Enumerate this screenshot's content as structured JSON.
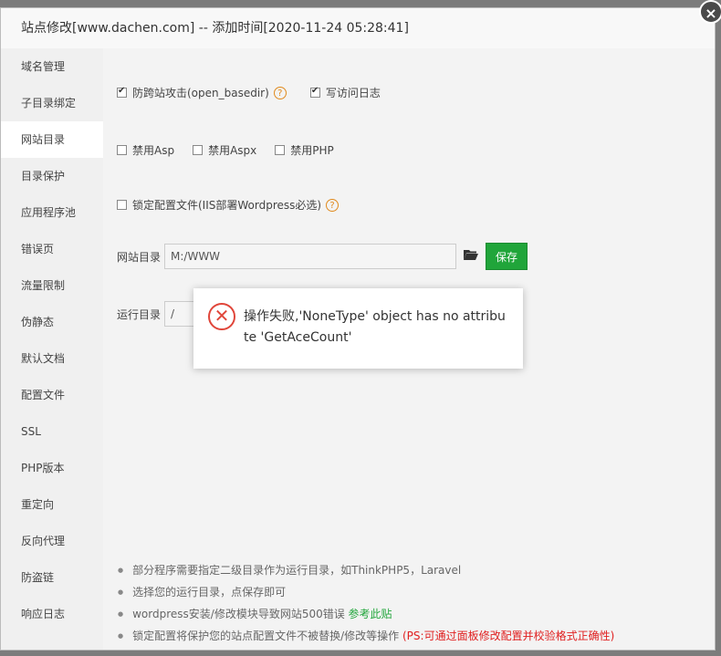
{
  "dialog": {
    "title": "站点修改[www.dachen.com] -- 添加时间[2020-11-24 05:28:41]",
    "close_symbol": "×"
  },
  "sidebar": {
    "items": [
      {
        "label": "域名管理"
      },
      {
        "label": "子目录绑定"
      },
      {
        "label": "网站目录",
        "active": true
      },
      {
        "label": "目录保护"
      },
      {
        "label": "应用程序池"
      },
      {
        "label": "错误页"
      },
      {
        "label": "流量限制"
      },
      {
        "label": "伪静态"
      },
      {
        "label": "默认文档"
      },
      {
        "label": "配置文件"
      },
      {
        "label": "SSL"
      },
      {
        "label": "PHP版本"
      },
      {
        "label": "重定向"
      },
      {
        "label": "反向代理"
      },
      {
        "label": "防盗链"
      },
      {
        "label": "响应日志"
      }
    ]
  },
  "options": {
    "open_basedir_label": "防跨站攻击(open_basedir)",
    "open_basedir_checked": true,
    "access_log_label": "写访问日志",
    "access_log_checked": true,
    "disable_asp_label": "禁用Asp",
    "disable_aspx_label": "禁用Aspx",
    "disable_php_label": "禁用PHP",
    "lock_config_label": "锁定配置文件(IIS部署Wordpress必选)",
    "help_symbol": "?"
  },
  "site_dir": {
    "label": "网站目录",
    "value": "M:/WWW",
    "save_label": "保存"
  },
  "run_dir": {
    "label": "运行目录",
    "value": "/"
  },
  "toast": {
    "message": "操作失败,'NoneType' object has no attribute 'GetAceCount'",
    "icon_symbol": "✕"
  },
  "tips": {
    "tip1": "部分程序需要指定二级目录作为运行目录，如ThinkPHP5，Laravel",
    "tip2": "选择您的运行目录，点保存即可",
    "tip3_text": "wordpress安装/修改模块导致网站500错误 ",
    "tip3_link": "参考此贴",
    "tip4_text": "锁定配置将保护您的站点配置文件不被替换/修改等操作 ",
    "tip4_warn": "(PS:可通过面板修改配置并校验格式正确性)"
  },
  "colors": {
    "accent_green": "#20a53a",
    "error_red": "#e0463a",
    "help_orange": "#e08a1e"
  }
}
